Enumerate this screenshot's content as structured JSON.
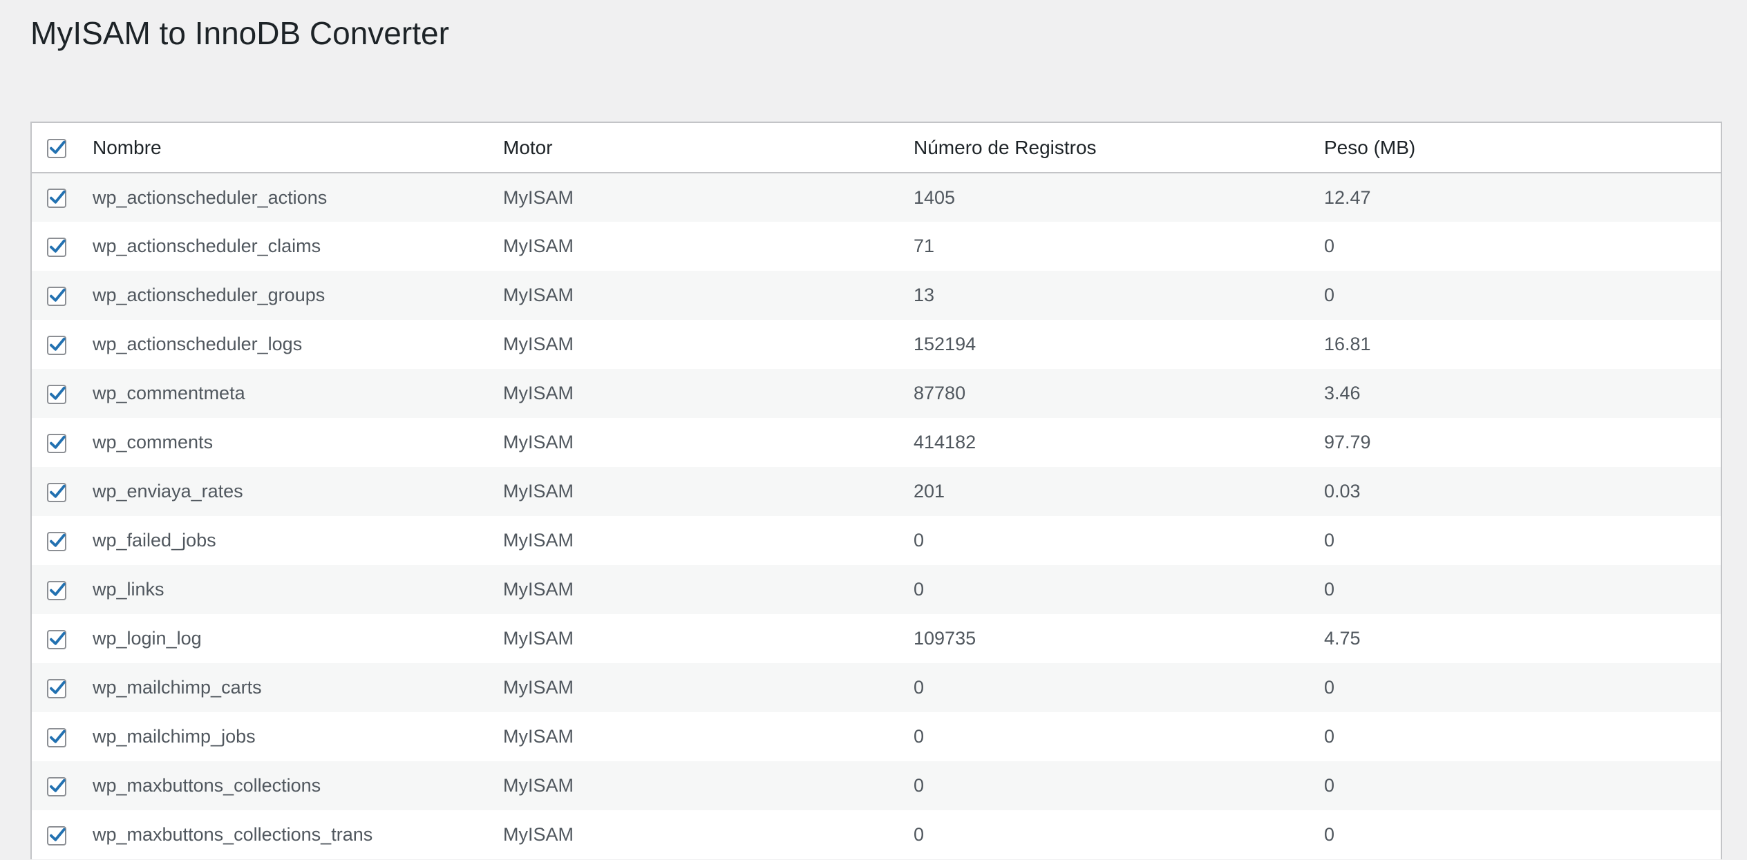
{
  "page": {
    "title": "MyISAM to InnoDB Converter"
  },
  "colors": {
    "background": "#f0f0f1",
    "check_accent": "#2271b1",
    "row_alt": "#f6f7f7",
    "border": "#c3c4c7"
  },
  "table": {
    "headers": {
      "name": "Nombre",
      "engine": "Motor",
      "rows": "Número de Registros",
      "size": "Peso (MB)"
    },
    "select_all_checked": true,
    "rows": [
      {
        "checked": true,
        "name": "wp_actionscheduler_actions",
        "engine": "MyISAM",
        "records": "1405",
        "size": "12.47"
      },
      {
        "checked": true,
        "name": "wp_actionscheduler_claims",
        "engine": "MyISAM",
        "records": "71",
        "size": "0"
      },
      {
        "checked": true,
        "name": "wp_actionscheduler_groups",
        "engine": "MyISAM",
        "records": "13",
        "size": "0"
      },
      {
        "checked": true,
        "name": "wp_actionscheduler_logs",
        "engine": "MyISAM",
        "records": "152194",
        "size": "16.81"
      },
      {
        "checked": true,
        "name": "wp_commentmeta",
        "engine": "MyISAM",
        "records": "87780",
        "size": "3.46"
      },
      {
        "checked": true,
        "name": "wp_comments",
        "engine": "MyISAM",
        "records": "414182",
        "size": "97.79"
      },
      {
        "checked": true,
        "name": "wp_enviaya_rates",
        "engine": "MyISAM",
        "records": "201",
        "size": "0.03"
      },
      {
        "checked": true,
        "name": "wp_failed_jobs",
        "engine": "MyISAM",
        "records": "0",
        "size": "0"
      },
      {
        "checked": true,
        "name": "wp_links",
        "engine": "MyISAM",
        "records": "0",
        "size": "0"
      },
      {
        "checked": true,
        "name": "wp_login_log",
        "engine": "MyISAM",
        "records": "109735",
        "size": "4.75"
      },
      {
        "checked": true,
        "name": "wp_mailchimp_carts",
        "engine": "MyISAM",
        "records": "0",
        "size": "0"
      },
      {
        "checked": true,
        "name": "wp_mailchimp_jobs",
        "engine": "MyISAM",
        "records": "0",
        "size": "0"
      },
      {
        "checked": true,
        "name": "wp_maxbuttons_collections",
        "engine": "MyISAM",
        "records": "0",
        "size": "0"
      },
      {
        "checked": true,
        "name": "wp_maxbuttons_collections_trans",
        "engine": "MyISAM",
        "records": "0",
        "size": "0"
      }
    ]
  }
}
